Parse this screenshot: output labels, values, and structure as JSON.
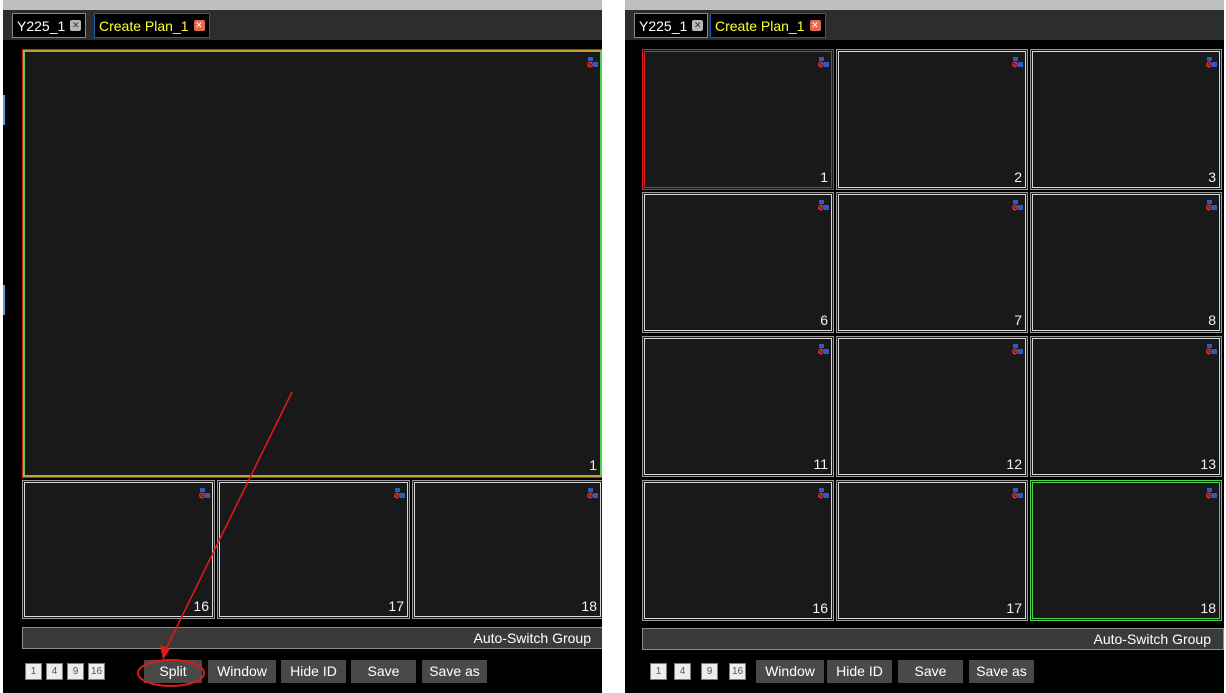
{
  "left": {
    "tabs": [
      {
        "label": "Y225_1",
        "close": "✕"
      },
      {
        "label": "Create Plan_1",
        "close": "✕"
      }
    ],
    "cells": {
      "big": "1",
      "a": "16",
      "b": "17",
      "c": "18"
    },
    "group_label": "Auto-Switch Group",
    "layout_buttons": [
      "1",
      "4",
      "9",
      "16"
    ],
    "buttons": {
      "split": "Split",
      "window": "Window",
      "hide_id": "Hide ID",
      "save": "Save",
      "save_as": "Save as"
    }
  },
  "right": {
    "tabs": [
      {
        "label": "Y225_1",
        "close": "✕"
      },
      {
        "label": "Create Plan_1",
        "close": "✕"
      }
    ],
    "cells": [
      "1",
      "2",
      "3",
      "6",
      "7",
      "8",
      "11",
      "12",
      "13",
      "16",
      "17",
      "18"
    ],
    "group_label": "Auto-Switch Group",
    "layout_buttons": [
      "1",
      "4",
      "9",
      "16"
    ],
    "buttons": {
      "window": "Window",
      "hide_id": "Hide ID",
      "save": "Save",
      "save_as": "Save as"
    }
  },
  "annotation": {
    "color": "#e01818"
  },
  "colors": {
    "tab_text_plan": "#ffff33",
    "cell_bg": "#191919",
    "selected_red": "#e02020",
    "selected_green": "#4cd44c"
  }
}
